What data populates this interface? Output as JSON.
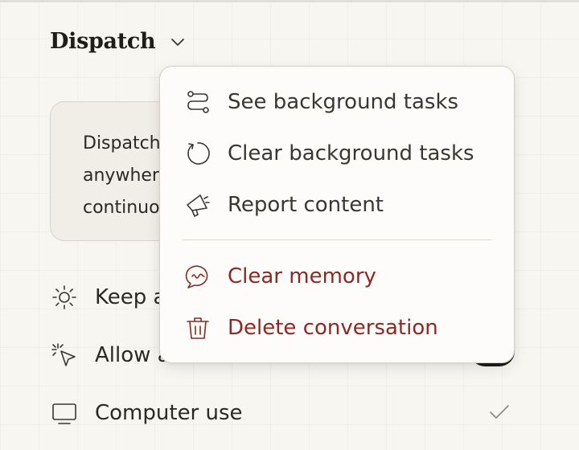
{
  "header": {
    "title": "Dispatch"
  },
  "info_card": {
    "lines": [
      "Dispatch",
      "anywher",
      "continuo"
    ]
  },
  "settings": [
    {
      "icon": "sun-icon",
      "label": "Keep a"
    },
    {
      "icon": "cursor-sparkle-icon",
      "label": "Allow all browser actions",
      "control": "toggle",
      "state": "on"
    },
    {
      "icon": "monitor-icon",
      "label": "Computer use",
      "control": "checkmark"
    }
  ],
  "menu": {
    "items": [
      {
        "icon": "route-icon",
        "label": "See background tasks",
        "variant": "neutral"
      },
      {
        "icon": "refresh-icon",
        "label": "Clear background tasks",
        "variant": "neutral"
      },
      {
        "icon": "megaphone-icon",
        "label": "Report content",
        "variant": "neutral"
      },
      {
        "icon": "memory-chat-icon",
        "label": "Clear memory",
        "variant": "danger"
      },
      {
        "icon": "trash-icon",
        "label": "Delete conversation",
        "variant": "danger"
      }
    ]
  },
  "colors": {
    "background": "#f8f6f1",
    "text": "#2b2926",
    "danger": "#8a2a22",
    "toggle_on": "#1f1d1a"
  }
}
